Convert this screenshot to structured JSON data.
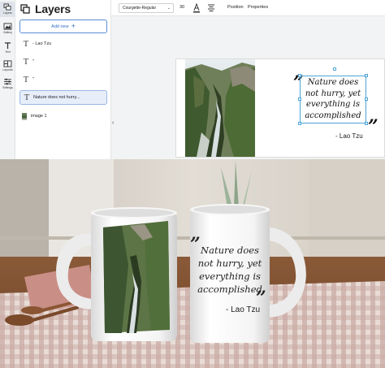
{
  "rail": [
    {
      "name": "Layers",
      "icon": "layers-icon"
    },
    {
      "name": "Gallery",
      "icon": "gallery-icon"
    },
    {
      "name": "Text",
      "icon": "text-icon"
    },
    {
      "name": "Layouts",
      "icon": "layouts-icon"
    },
    {
      "name": "Settings",
      "icon": "settings-icon"
    }
  ],
  "panel": {
    "title": "Layers",
    "add_label": "Add new",
    "layers": [
      {
        "glyph": "T",
        "label": "- Lao Tzu"
      },
      {
        "glyph": "T",
        "label": "\""
      },
      {
        "glyph": "T",
        "label": "\""
      },
      {
        "glyph": "T",
        "label": "Nature does not hurry..."
      },
      {
        "glyph": "",
        "label": "image 1"
      }
    ]
  },
  "toolbar": {
    "font": "Courgette-Regular",
    "font_size": "30",
    "position_label": "Position",
    "properties_label": "Properties"
  },
  "quote": {
    "lines": [
      "Nature does",
      "not hurry, yet",
      "everything is",
      "accomplished"
    ],
    "author": "- Lao Tzu",
    "open_mark": "”",
    "close_mark": "”"
  },
  "colors": {
    "accent": "#4aa3d8",
    "button_border": "#5b8dd6"
  }
}
